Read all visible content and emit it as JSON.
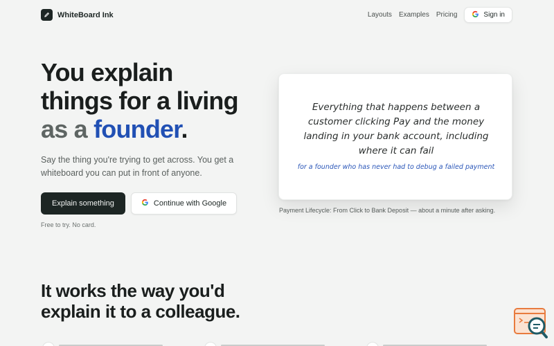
{
  "header": {
    "brand_name": "WhiteBoard Ink",
    "nav": [
      "Layouts",
      "Examples",
      "Pricing"
    ],
    "signin_label": "Sign in"
  },
  "hero": {
    "title_line1": "You explain",
    "title_line2": "things for a living",
    "title_line3_prefix": "as a ",
    "title_line3_accent": "founder",
    "title_line3_suffix": ".",
    "subtitle": "Say the thing you're trying to get across. You get a whiteboard you can put in front of anyone.",
    "primary_cta": "Explain something",
    "google_cta": "Continue with Google",
    "note": "Free to try. No card."
  },
  "whiteboard": {
    "main_text": "Everything that happens between a customer clicking Pay and the money landing in your bank account, including where it can fail",
    "audience_text": "for a founder who has never had to debug a failed payment",
    "caption": "Payment Lifecycle: From Click to Bank Deposit — about a minute after asking."
  },
  "section2": {
    "title_line1": "It works the way you'd",
    "title_line2": "explain it to a colleague."
  },
  "colors": {
    "accent": "#2150b4",
    "dark": "#1d2624",
    "background": "#f3f4f3",
    "widget_orange": "#e87b3e",
    "widget_teal": "#1f5b66"
  },
  "icons": {
    "brand": "pen-icon",
    "google": "google-icon",
    "widget": "search-chat-icon"
  }
}
